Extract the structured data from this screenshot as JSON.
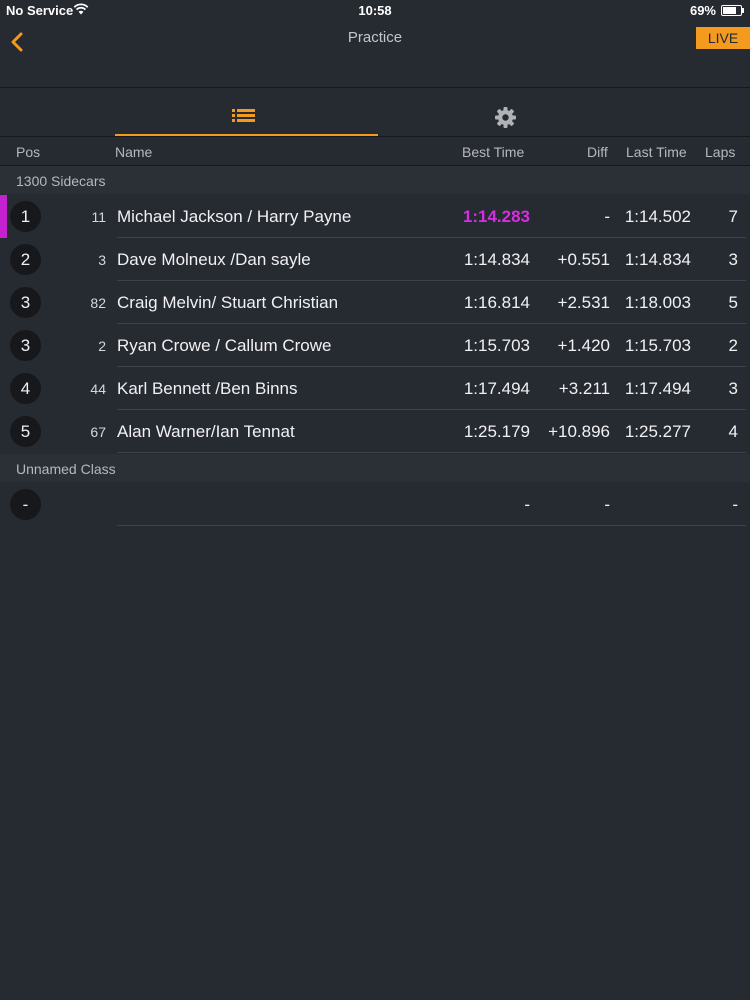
{
  "status": {
    "carrier": "No Service",
    "time": "10:58",
    "battery": "69%"
  },
  "nav": {
    "title": "Practice",
    "live": "LIVE",
    "back_icon": "chevron-left-icon"
  },
  "tabs": [
    {
      "icon": "list-icon",
      "selected": true
    },
    {
      "icon": "gear-icon",
      "selected": false
    }
  ],
  "columns": {
    "pos": "Pos",
    "name": "Name",
    "best": "Best Time",
    "diff": "Diff",
    "last": "Last Time",
    "laps": "Laps"
  },
  "classes": [
    {
      "name": "1300 Sidecars",
      "rows": [
        {
          "pos": "1",
          "num": "11",
          "name": "Michael Jackson / Harry Payne",
          "best": "1:14.283",
          "diff": "-",
          "last": "1:14.502",
          "laps": "7",
          "best_highlight": true,
          "marker": true
        },
        {
          "pos": "2",
          "num": "3",
          "name": "Dave Molneux /Dan sayle",
          "best": "1:14.834",
          "diff": "+0.551",
          "last": "1:14.834",
          "laps": "3"
        },
        {
          "pos": "3",
          "num": "82",
          "name": "Craig Melvin/ Stuart Christian",
          "best": "1:16.814",
          "diff": "+2.531",
          "last": "1:18.003",
          "laps": "5"
        },
        {
          "pos": "3",
          "num": "2",
          "name": "Ryan Crowe / Callum Crowe",
          "best": "1:15.703",
          "diff": "+1.420",
          "last": "1:15.703",
          "laps": "2"
        },
        {
          "pos": "4",
          "num": "44",
          "name": "Karl Bennett /Ben Binns",
          "best": "1:17.494",
          "diff": "+3.211",
          "last": "1:17.494",
          "laps": "3"
        },
        {
          "pos": "5",
          "num": "67",
          "name": "Alan Warner/Ian Tennat",
          "best": "1:25.179",
          "diff": "+10.896",
          "last": "1:25.277",
          "laps": "4"
        }
      ]
    },
    {
      "name": "Unnamed Class",
      "rows": [
        {
          "pos": "-",
          "num": "",
          "name": "",
          "best": "-",
          "diff": "-",
          "last": "",
          "laps": "-"
        }
      ]
    }
  ],
  "colors": {
    "accent": "#f39a1f",
    "fastest": "#d42fe0",
    "background": "#262a31"
  }
}
